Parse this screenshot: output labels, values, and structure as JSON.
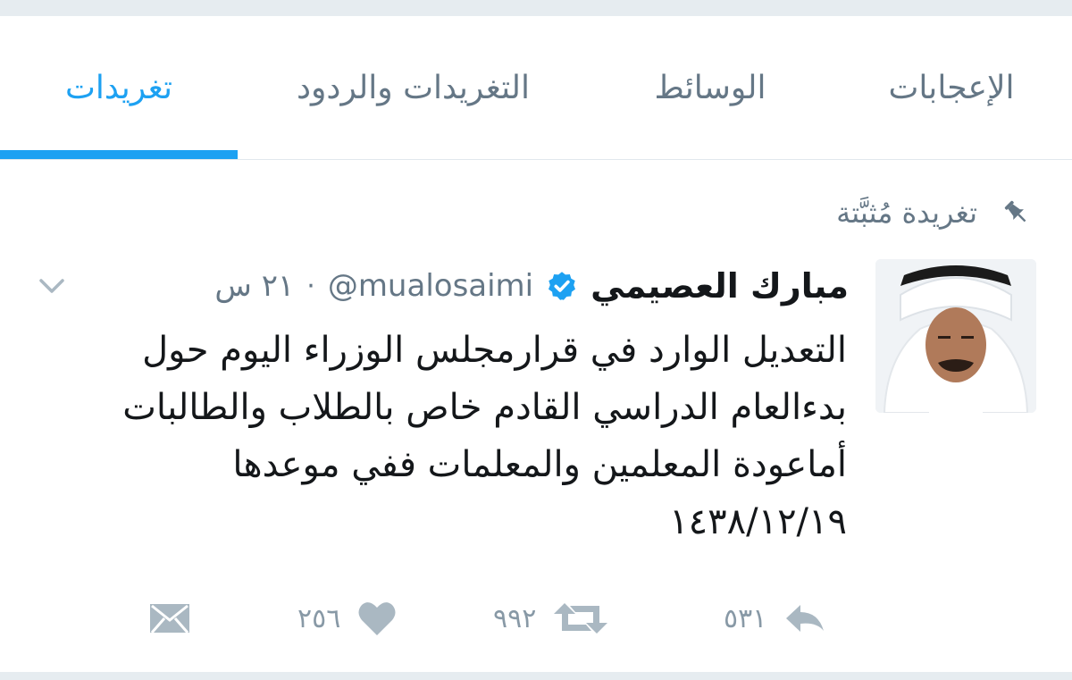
{
  "tabs": [
    {
      "label": "الإعجابات",
      "active": false
    },
    {
      "label": "الوسائط",
      "active": false
    },
    {
      "label": "التغريدات والردود",
      "active": false
    },
    {
      "label": "تغريدات",
      "active": true
    }
  ],
  "pinned": {
    "label": "تغريدة مُثبَّتة",
    "icon": "pin-icon"
  },
  "tweet": {
    "author_name": "مبارك العصيمي",
    "verified": true,
    "handle": "@mualosaimi",
    "separator": "·",
    "time": "٢١ س",
    "text_lines": [
      "التعديل الوارد في قرارمجلس الوزراء اليوم  حول",
      "بدءالعام الدراسي القادم خاص بالطلاب والطالبات",
      "أماعودة المعلمين والمعلمات ففي موعدها",
      "١٤٣٨/١٢/١٩"
    ],
    "actions": {
      "reply": {
        "icon": "reply-icon",
        "count": "٥٣١"
      },
      "retweet": {
        "icon": "retweet-icon",
        "count": "٩٩٢"
      },
      "like": {
        "icon": "heart-icon",
        "count": "٢٥٦"
      },
      "message": {
        "icon": "envelope-icon"
      }
    }
  },
  "colors": {
    "accent": "#1da1f2",
    "muted": "#657786",
    "icon_gray": "#aab8c2",
    "text": "#14171a"
  }
}
